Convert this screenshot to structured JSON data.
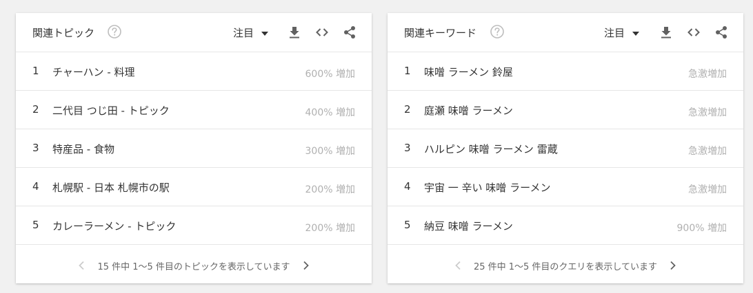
{
  "colors": {
    "background": "#f1f1f1",
    "card": "#ffffff",
    "text": "#333333",
    "muted": "#b0b0b0",
    "icon": "#616161",
    "divider": "#e6e6e6"
  },
  "topics": {
    "title": "関連トピック",
    "help_icon": "help-circle-icon",
    "sort_label": "注目",
    "rows": [
      {
        "rank": "1",
        "label": "チャーハン - 料理",
        "value": "600% 増加"
      },
      {
        "rank": "2",
        "label": "二代目 つじ田 - トピック",
        "value": "400% 増加"
      },
      {
        "rank": "3",
        "label": "特産品 - 食物",
        "value": "300% 増加"
      },
      {
        "rank": "4",
        "label": "札幌駅 - 日本 札幌市の駅",
        "value": "200% 増加"
      },
      {
        "rank": "5",
        "label": "カレーラーメン - トピック",
        "value": "200% 増加"
      }
    ],
    "pager_text": "15 件中 1～5 件目のトピックを表示しています"
  },
  "queries": {
    "title": "関連キーワード",
    "help_icon": "help-circle-icon",
    "sort_label": "注目",
    "rows": [
      {
        "rank": "1",
        "label": "味噌 ラーメン 鈴屋",
        "value": "急激増加"
      },
      {
        "rank": "2",
        "label": "庭瀬 味噌 ラーメン",
        "value": "急激増加"
      },
      {
        "rank": "3",
        "label": "ハルピン 味噌 ラーメン 雷蔵",
        "value": "急激増加"
      },
      {
        "rank": "4",
        "label": "宇宙 一 辛い 味噌 ラーメン",
        "value": "急激増加"
      },
      {
        "rank": "5",
        "label": "納豆 味噌 ラーメン",
        "value": "900% 増加"
      }
    ],
    "pager_text": "25 件中 1～5 件目のクエリを表示しています"
  }
}
